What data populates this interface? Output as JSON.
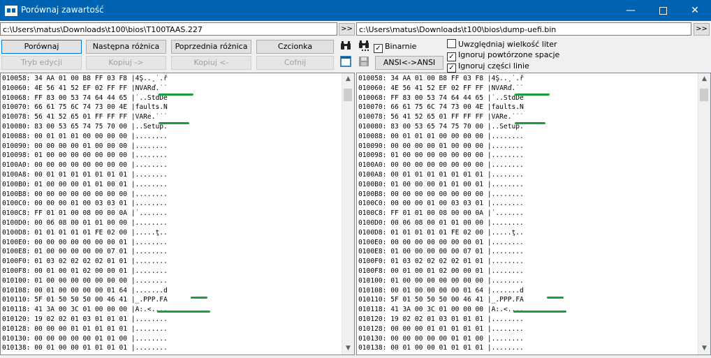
{
  "window": {
    "title": "Porównaj zawartość"
  },
  "left_path": "c:\\Users\\matus\\Downloads\\t100\\bios\\T100TAAS.227",
  "right_path": "c:\\Users\\matus\\Downloads\\t100\\bios\\dump-uefi.bin",
  "path_button": ">>",
  "buttons": {
    "compare": "Porównaj",
    "next_diff": "Następna różnica",
    "prev_diff": "Poprzednia różnica",
    "font": "Czcionka",
    "edit_mode": "Tryb edycji",
    "copy_right": "Kopiuj ->",
    "copy_left": "Kopiuj <-",
    "undo": "Cofnij",
    "ansi": "ANSI<->ANSI"
  },
  "checkboxes": {
    "binary": {
      "label": "Binarnie",
      "checked": "✓"
    },
    "case": {
      "label": "Uwzględniaj wielkość liter",
      "checked": ""
    },
    "spaces": {
      "label": "Ignoruj powtórzone spacje",
      "checked": "✓"
    },
    "partial": {
      "label": "Ignoruj części linie",
      "checked": "✓"
    }
  },
  "left_lines": [
    "010058: 34 AA 01 00 B8 FF 03 F8 |4Ş..¸˙.ř",
    "010060: 4E 56 41 52 EF 02 FF FF |NVARď.˙˙",
    "010068: FF 83 00 53 74 64 44 65 |˙..StdDe",
    "010070: 66 61 75 6C 74 73 00 4E |faults.N",
    "010078: 56 41 52 65 01 FF FF FF |VARe.˙˙˙",
    "010080: 83 00 53 65 74 75 70 00 |..Setup.",
    "010088: 00 01 01 01 00 00 00 00 |........",
    "010090: 00 00 00 00 01 00 00 00 |........",
    "010098: 01 00 00 00 00 00 00 00 |........",
    "0100A0: 00 00 00 00 00 00 00 00 |........",
    "0100A8: 00 01 01 01 01 01 01 01 |........",
    "0100B0: 01 00 00 00 01 01 00 01 |........",
    "0100B8: 00 00 00 00 00 00 00 00 |........",
    "0100C0: 00 00 00 01 00 03 03 01 |........",
    "0100C8: FF 01 01 00 08 00 00 0A |˙.......",
    "0100D0: 00 06 08 00 01 01 00 00 |........",
    "0100D8: 01 01 01 01 01 FE 02 00 |.....ţ..",
    "0100E0: 00 00 00 00 00 00 00 01 |........",
    "0100E8: 01 00 00 00 00 00 07 01 |........",
    "0100F0: 01 03 02 02 02 02 01 01 |........",
    "0100F8: 00 01 00 01 02 00 00 01 |........",
    "010100: 01 00 00 00 00 00 00 00 |........",
    "010108: 00 01 00 00 00 00 01 64 |.......d",
    "010110: 5F 01 50 50 50 00 46 41 |_.PPP.FA",
    "010118: 41 3A 00 3C 01 00 00 00 |A:.<....",
    "010120: 19 02 02 01 03 01 01 01 |........",
    "010128: 00 00 00 01 01 01 01 01 |........",
    "010130: 00 00 00 00 00 01 01 00 |........",
    "010138: 00 01 00 00 01 01 01 01 |........"
  ],
  "right_lines": [
    "010058: 34 AA 01 00 B8 FF 03 F8 |4Ş..¸˙.ř",
    "010060: 4E 56 41 52 EF 02 FF FF |NVARď.˙˙",
    "010068: FF 83 00 53 74 64 44 65 |˙..StdDe",
    "010070: 66 61 75 6C 74 73 00 4E |faults.N",
    "010078: 56 41 52 65 01 FF FF FF |VARe.˙˙˙",
    "010080: 83 00 53 65 74 75 70 00 |..Setup.",
    "010088: 00 01 01 01 00 00 00 00 |........",
    "010090: 00 00 00 00 01 00 00 00 |........",
    "010098: 01 00 00 00 00 00 00 00 |........",
    "0100A0: 00 00 00 00 00 00 00 00 |........",
    "0100A8: 00 01 01 01 01 01 01 01 |........",
    "0100B0: 01 00 00 00 01 01 00 01 |........",
    "0100B8: 00 00 00 00 00 00 00 00 |........",
    "0100C0: 00 00 00 01 00 03 03 01 |........",
    "0100C8: FF 01 01 00 08 00 00 0A |˙.......",
    "0100D0: 00 06 08 00 01 01 00 00 |........",
    "0100D8: 01 01 01 01 01 FE 02 00 |.....ţ..",
    "0100E0: 00 00 00 00 00 00 00 01 |........",
    "0100E8: 01 00 00 00 00 00 07 01 |........",
    "0100F0: 01 03 02 02 02 02 01 01 |........",
    "0100F8: 00 01 00 01 02 00 00 01 |........",
    "010100: 01 00 00 00 00 00 00 00 |........",
    "010108: 00 01 00 00 00 00 01 64 |.......d",
    "010110: 5F 01 50 50 50 00 46 41 |_.PPP.FA",
    "010118: 41 3A 00 3C 01 00 00 00 |A:.<....",
    "010120: 19 02 02 01 03 01 01 01 |........",
    "010128: 00 00 00 01 01 01 01 01 |........",
    "010130: 00 00 00 00 00 01 01 00 |........",
    "010138: 00 01 00 00 01 01 01 01 |........"
  ],
  "highlight_color": "#1b9e3e"
}
